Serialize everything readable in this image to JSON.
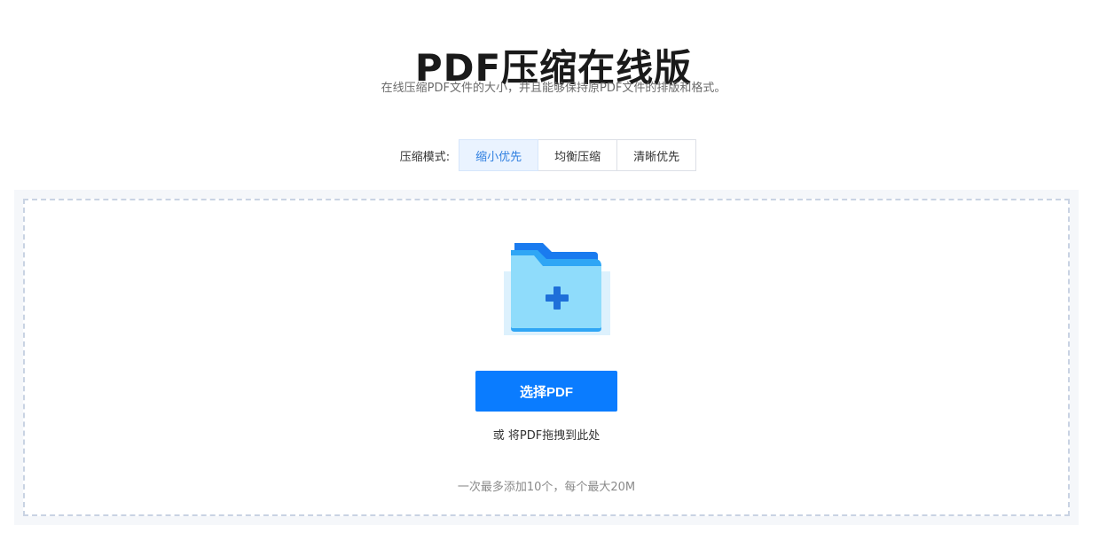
{
  "header": {
    "title": "PDF压缩在线版",
    "subtitle": "在线压缩PDF文件的大小，并且能够保持原PDF文件的排版和格式。"
  },
  "compression_mode": {
    "label": "压缩模式:",
    "options": [
      {
        "label": "缩小优先",
        "selected": true
      },
      {
        "label": "均衡压缩",
        "selected": false
      },
      {
        "label": "清晰优先",
        "selected": false
      }
    ]
  },
  "upload": {
    "icon": "folder-plus-icon",
    "button_label": "选择PDF",
    "drag_hint": "或 将PDF拖拽到此处",
    "limit_hint": "一次最多添加10个，每个最大20M"
  },
  "colors": {
    "accent": "#0a7cff",
    "selected_bg": "#eaf3ff",
    "selected_text": "#2f7fe0",
    "panel_bg": "#f5f7fa",
    "dash_border": "#c9d3e3"
  }
}
